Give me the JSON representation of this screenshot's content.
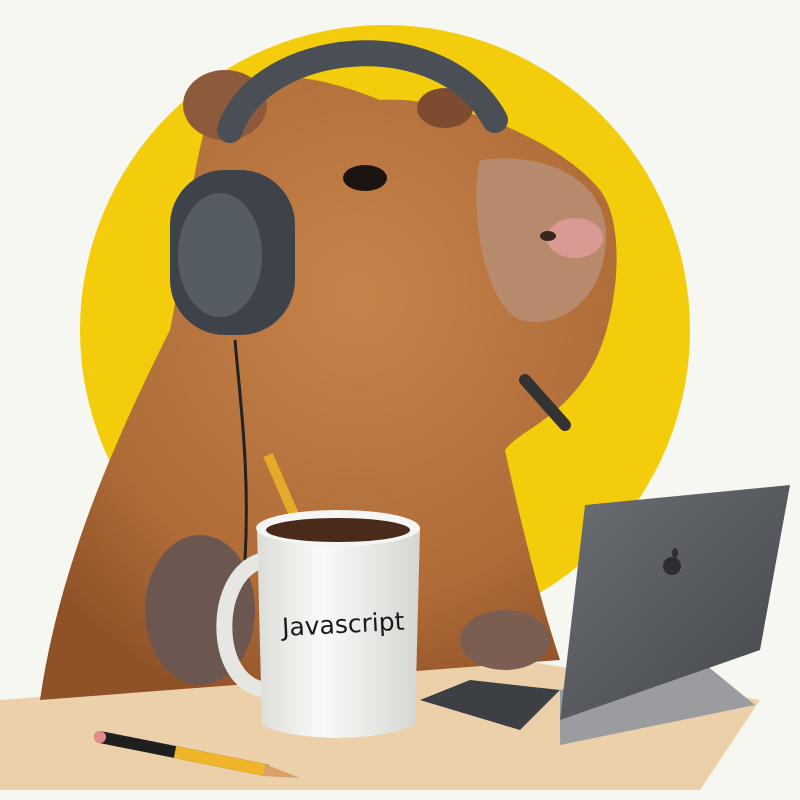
{
  "illustration": {
    "mug_text": "Javascript",
    "logo_icon": "apple-logo-icon"
  },
  "colors": {
    "background": "#f7f7f2",
    "sun": "#f3cd0c",
    "fur": "#b5703c",
    "fur_dark": "#8a4f27",
    "headphones": "#4a4f55",
    "mug": "#f2f2f0",
    "laptop": "#5b5e63",
    "table": "#e9c9a0"
  }
}
